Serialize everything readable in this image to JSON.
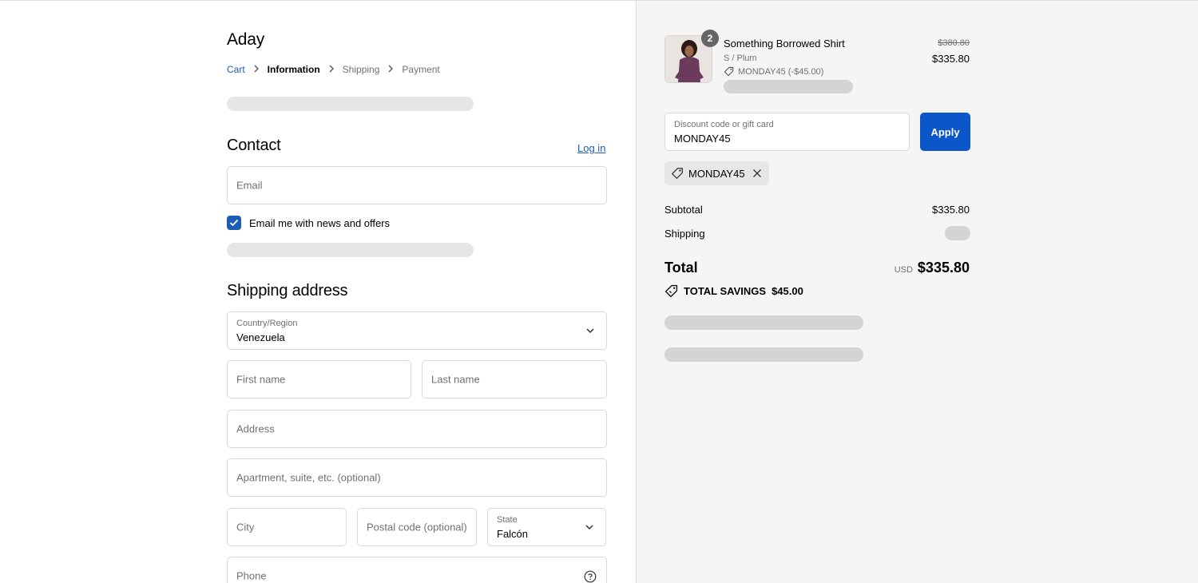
{
  "store": {
    "name": "Aday"
  },
  "breadcrumb": {
    "cart": "Cart",
    "information": "Information",
    "shipping": "Shipping",
    "payment": "Payment"
  },
  "contact": {
    "heading": "Contact",
    "login": "Log in",
    "email_placeholder": "Email",
    "news_label": "Email me with news and offers",
    "news_checked": true
  },
  "shipping_address": {
    "heading": "Shipping address",
    "country_label": "Country/Region",
    "country_value": "Venezuela",
    "first_name_placeholder": "First name",
    "last_name_placeholder": "Last name",
    "address_placeholder": "Address",
    "apartment_placeholder": "Apartment, suite, etc. (optional)",
    "city_placeholder": "City",
    "postal_placeholder": "Postal code (optional)",
    "state_label": "State",
    "state_value": "Falcón",
    "phone_placeholder": "Phone"
  },
  "order": {
    "item": {
      "quantity": "2",
      "name": "Something Borrowed Shirt",
      "variant": "S / Plum",
      "discount": "MONDAY45 (-$45.00)",
      "original_price": "$380.80",
      "price": "$335.80"
    },
    "discount_field": {
      "label": "Discount code or gift card",
      "value": "MONDAY45"
    },
    "apply_label": "Apply",
    "applied_code": "MONDAY45",
    "subtotal_label": "Subtotal",
    "subtotal_value": "$335.80",
    "shipping_label": "Shipping",
    "total_label": "Total",
    "currency": "USD",
    "total_value": "$335.80",
    "savings_label": "TOTAL SAVINGS",
    "savings_value": "$45.00"
  },
  "colors": {
    "accent": "#0b56c9",
    "link": "#1a5fb4",
    "summary_bg": "#f5f5f5"
  }
}
